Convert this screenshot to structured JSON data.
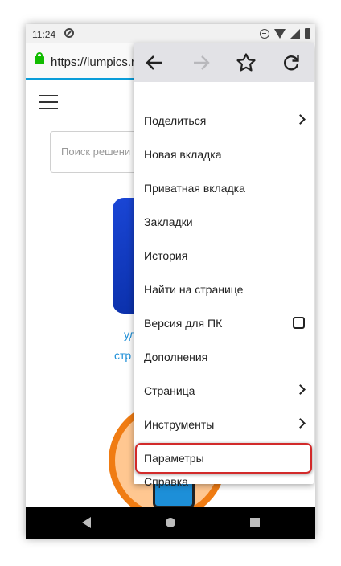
{
  "status_bar": {
    "time": "11:24",
    "icons": [
      "do-not-disturb-icon",
      "wifi-icon",
      "signal-icon",
      "battery-icon"
    ]
  },
  "url_bar": {
    "url": "https://lumpics.r",
    "secure_icon": "lock-icon",
    "accent_color": "#12bc00"
  },
  "page": {
    "search_placeholder": "Поиск решени",
    "link_line1": "уд",
    "link_line2": "стр"
  },
  "menu": {
    "toolbar": [
      "back-arrow-icon",
      "forward-arrow-icon",
      "star-icon",
      "reload-icon"
    ],
    "items": [
      {
        "label": "Поделиться",
        "trailing": "chevron"
      },
      {
        "label": "Новая вкладка"
      },
      {
        "label": "Приватная вкладка"
      },
      {
        "label": "Закладки"
      },
      {
        "label": "История"
      },
      {
        "label": "Найти на странице"
      },
      {
        "label": "Версия для ПК",
        "trailing": "checkbox",
        "checked": false
      },
      {
        "label": "Дополнения"
      },
      {
        "label": "Страница",
        "trailing": "chevron"
      },
      {
        "label": "Инструменты",
        "trailing": "chevron"
      },
      {
        "label": "Параметры",
        "highlighted": true
      },
      {
        "label": "Справка"
      }
    ],
    "highlight_color": "#d22a2a"
  },
  "nav_bar": {
    "buttons": [
      "back-icon",
      "home-icon",
      "recents-icon"
    ]
  }
}
